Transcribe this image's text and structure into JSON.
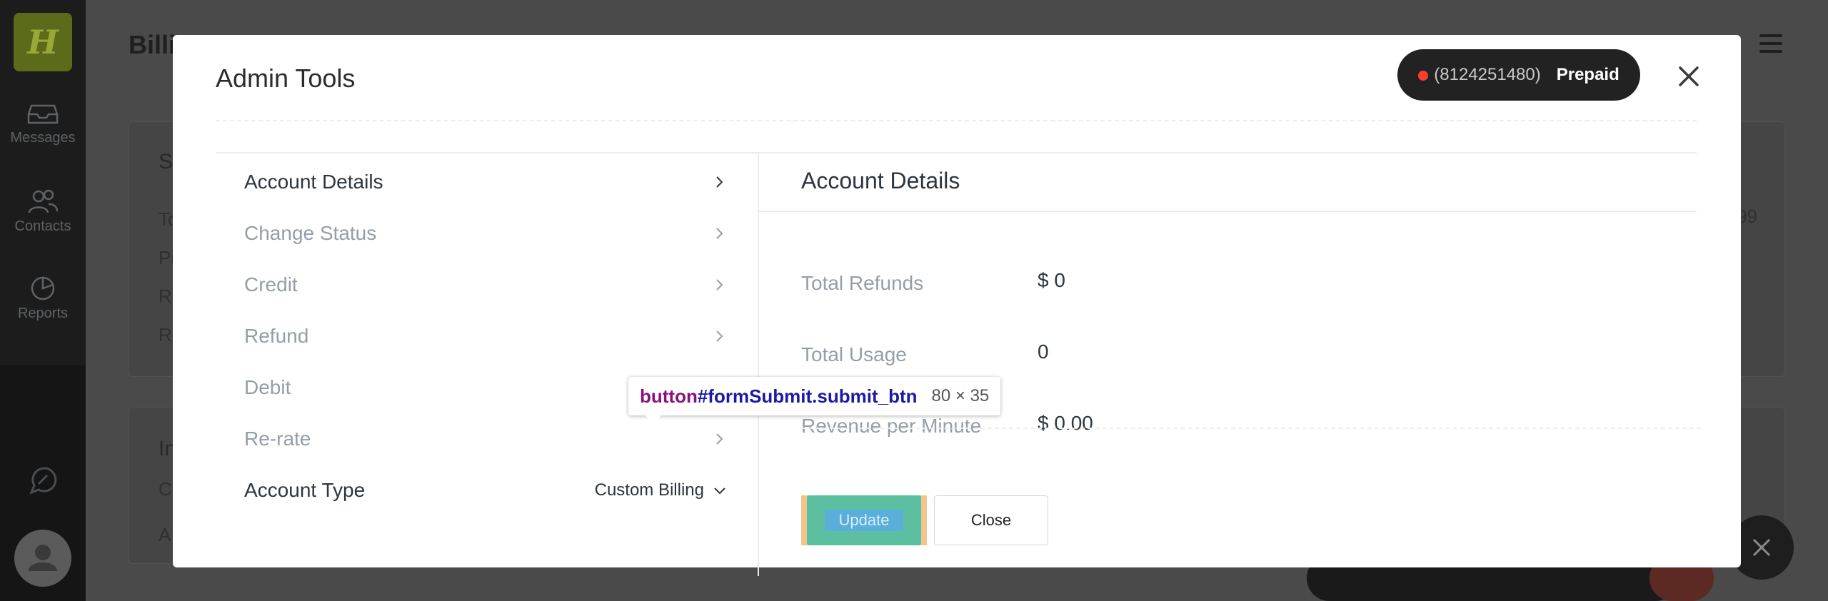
{
  "background": {
    "logo_letter": "H",
    "nav": [
      {
        "label": "Messages",
        "icon": "inbox-icon"
      },
      {
        "label": "Contacts",
        "icon": "contacts-icon"
      },
      {
        "label": "Reports",
        "icon": "pie-chart-icon"
      }
    ],
    "header_title": "Billi",
    "fragments": [
      "S",
      "To",
      "Pi",
      "R",
      "R",
      "In",
      "C",
      "A",
      "99"
    ]
  },
  "modal": {
    "title": "Admin Tools",
    "phone_number": "(8124251480)",
    "plan": "Prepaid",
    "menu": [
      {
        "label": "Account Details"
      },
      {
        "label": "Change Status"
      },
      {
        "label": "Credit"
      },
      {
        "label": "Refund"
      },
      {
        "label": "Debit"
      },
      {
        "label": "Re-rate"
      }
    ],
    "account_type": {
      "label": "Account Type",
      "value": "Custom Billing"
    },
    "details": {
      "title": "Account Details",
      "rows": [
        {
          "label": "Total Refunds",
          "value": "$ 0"
        },
        {
          "label": "Total Usage",
          "value": "0"
        },
        {
          "label": "Revenue per Minute",
          "value": "$ 0.00"
        }
      ]
    },
    "buttons": {
      "update": "Update",
      "close": "Close"
    }
  },
  "devtools_tooltip": {
    "tag": "button",
    "selector": "#formSubmit.submit_btn",
    "dimensions": "80 × 35"
  },
  "colors": {
    "status_dot": "#ff3b30",
    "update_button": "#5bbfa0",
    "logo_bg": "#5c6b1a"
  }
}
